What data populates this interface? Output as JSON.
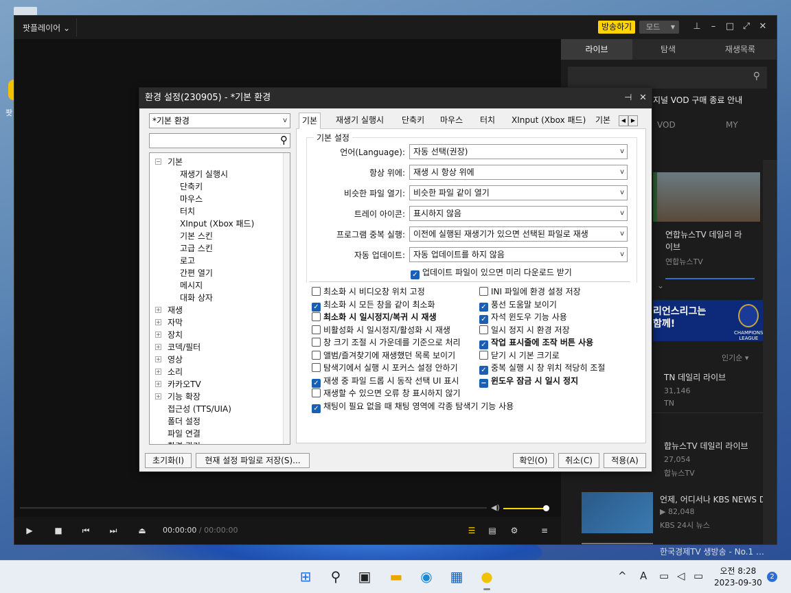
{
  "desktop": {
    "label": "팟"
  },
  "player": {
    "app_name": "팟플레이어 ⌄",
    "broadcast": "방송하기",
    "mode": "모드",
    "time_cur": "00:00:00",
    "time_sep": "/ 00:00:00",
    "volume_level": 0.9
  },
  "side": {
    "tabs": [
      "라이브",
      "탐색",
      "재생목록"
    ],
    "notice": "지널 VOD 구매 종료 안내",
    "subtabs": [
      "VOD",
      "MY"
    ],
    "cards": [
      {
        "title": "연합뉴스TV 데일리 라\n이브",
        "channel": "연합뉴스TV"
      }
    ],
    "banner": "리언스리그는\n함께!",
    "banner_logo": "CHAMPIONS\nLEAGUE",
    "sort": "인기순 ▾",
    "list": [
      {
        "title": "TN 데일리 라이브",
        "count": "31,146",
        "channel": "TN"
      },
      {
        "title": "합뉴스TV 데일리 라이브",
        "count": "27,054",
        "channel": "합뉴스TV"
      },
      {
        "title": "언제, 어디서나 KBS NEWS D",
        "count": "▶ 82,048",
        "channel": "KBS 24시 뉴스"
      },
      {
        "title": "한국경제TV 생방송 - No.1 …",
        "count": "",
        "channel": ""
      }
    ]
  },
  "dialog": {
    "title": "환경 설정(230905) - *기본 환경",
    "preset": "*기본 환경",
    "tree": [
      {
        "label": "기본",
        "box": "⊟",
        "level": 0
      },
      {
        "label": "재생기 실행시",
        "level": 1
      },
      {
        "label": "단축키",
        "level": 1
      },
      {
        "label": "마우스",
        "level": 1
      },
      {
        "label": "터치",
        "level": 1
      },
      {
        "label": "XInput (Xbox 패드)",
        "level": 1
      },
      {
        "label": "기본 스킨",
        "level": 1
      },
      {
        "label": "고급 스킨",
        "level": 1
      },
      {
        "label": "로고",
        "level": 1
      },
      {
        "label": "간편 열기",
        "level": 1
      },
      {
        "label": "메시지",
        "level": 1
      },
      {
        "label": "대화 상자",
        "level": 1
      },
      {
        "label": "재생",
        "box": "⊞",
        "level": 0
      },
      {
        "label": "자막",
        "box": "⊞",
        "level": 0
      },
      {
        "label": "장치",
        "box": "⊞",
        "level": 0
      },
      {
        "label": "코덱/필터",
        "box": "⊞",
        "level": 0
      },
      {
        "label": "영상",
        "box": "⊞",
        "level": 0
      },
      {
        "label": "소리",
        "box": "⊞",
        "level": 0
      },
      {
        "label": "카카오TV",
        "box": "⊞",
        "level": 0
      },
      {
        "label": "기능 확장",
        "box": "⊞",
        "level": 0
      },
      {
        "label": "접근성 (TTS/UIA)",
        "level": 0
      },
      {
        "label": "폴더 설정",
        "level": 0
      },
      {
        "label": "파일 연결",
        "level": 0
      },
      {
        "label": "환경 관리",
        "level": 0
      }
    ],
    "tabs": [
      "기본",
      "재생기 실행시",
      "단축키",
      "마우스",
      "터치",
      "XInput (Xbox 패드)",
      "기본"
    ],
    "group": "기본 설정",
    "rows": [
      {
        "label": "언어(Language):",
        "value": "자동 선택(권장)"
      },
      {
        "label": "항상 위에:",
        "value": "재생 시 항상 위에"
      },
      {
        "label": "비슷한 파일 열기:",
        "value": "비슷한 파일 같이 열기"
      },
      {
        "label": "트레이 아이콘:",
        "value": "표시하지 않음"
      },
      {
        "label": "프로그램 중복 실행:",
        "value": "이전에 실행된 재생기가 있으면 선택된 파일로 재생"
      },
      {
        "label": "자동 업데이트:",
        "value": "자동 업데이트를 하지 않음"
      }
    ],
    "prefetch": "업데이트 파일이 있으면 미리 다운로드 받기",
    "left_checks": [
      {
        "label": "최소화 시 비디오창 위치 고정",
        "checked": false,
        "bold": false
      },
      {
        "label": "최소화 시 모든 창을 같이 최소화",
        "checked": true,
        "bold": false
      },
      {
        "label": "최소화 시 일시정지/복귀 시 재생",
        "checked": false,
        "bold": true
      },
      {
        "label": "비활성화 시 일시정지/활성화 시 재생",
        "checked": false,
        "bold": false
      },
      {
        "label": "창 크기 조절 시 가운데를 기준으로 처리",
        "checked": false,
        "bold": false
      },
      {
        "label": "앨범/즐겨찾기에 재생했던 목록 보이기",
        "checked": false,
        "bold": false
      },
      {
        "label": "탐색기에서 실행 시 포커스 설정 안하기",
        "checked": false,
        "bold": false
      },
      {
        "label": "재생 중 파일 드롭 시 동작 선택 UI 표시",
        "checked": true,
        "bold": false
      },
      {
        "label": "재생할 수 있으면 오류 창 표시하지 않기",
        "checked": false,
        "bold": false
      },
      {
        "label": "채팅이 필요 없을 때 채팅 영역에 각종 탐색기 기능 사용",
        "checked": true,
        "bold": false
      }
    ],
    "right_checks": [
      {
        "label": "INI 파일에 환경 설정 저장",
        "checked": false,
        "bold": false
      },
      {
        "label": "풍선 도움말 보이기",
        "checked": true,
        "bold": false
      },
      {
        "label": "자석 윈도우 기능 사용",
        "checked": true,
        "bold": false
      },
      {
        "label": "일시 정지 시 환경 저장",
        "checked": false,
        "bold": false
      },
      {
        "label": "작업 표시줄에 조작 버튼 사용",
        "checked": true,
        "bold": true
      },
      {
        "label": "닫기 시 기본 크기로",
        "checked": false,
        "bold": false
      },
      {
        "label": "중복 실행 시 창 위치 적당히 조절",
        "checked": true,
        "bold": false
      },
      {
        "label": "윈도우 잠금 시 일시 정지",
        "checked": "ind",
        "bold": true
      }
    ],
    "buttons": {
      "reset": "초기화(I)",
      "save": "현재 설정 파일로 저장(S)...",
      "ok": "확인(O)",
      "cancel": "취소(C)",
      "apply": "적용(A)"
    }
  },
  "taskbar": {
    "clock_time": "오전 8:28",
    "clock_date": "2023-09-30",
    "ime": "A",
    "notif_count": "2"
  }
}
